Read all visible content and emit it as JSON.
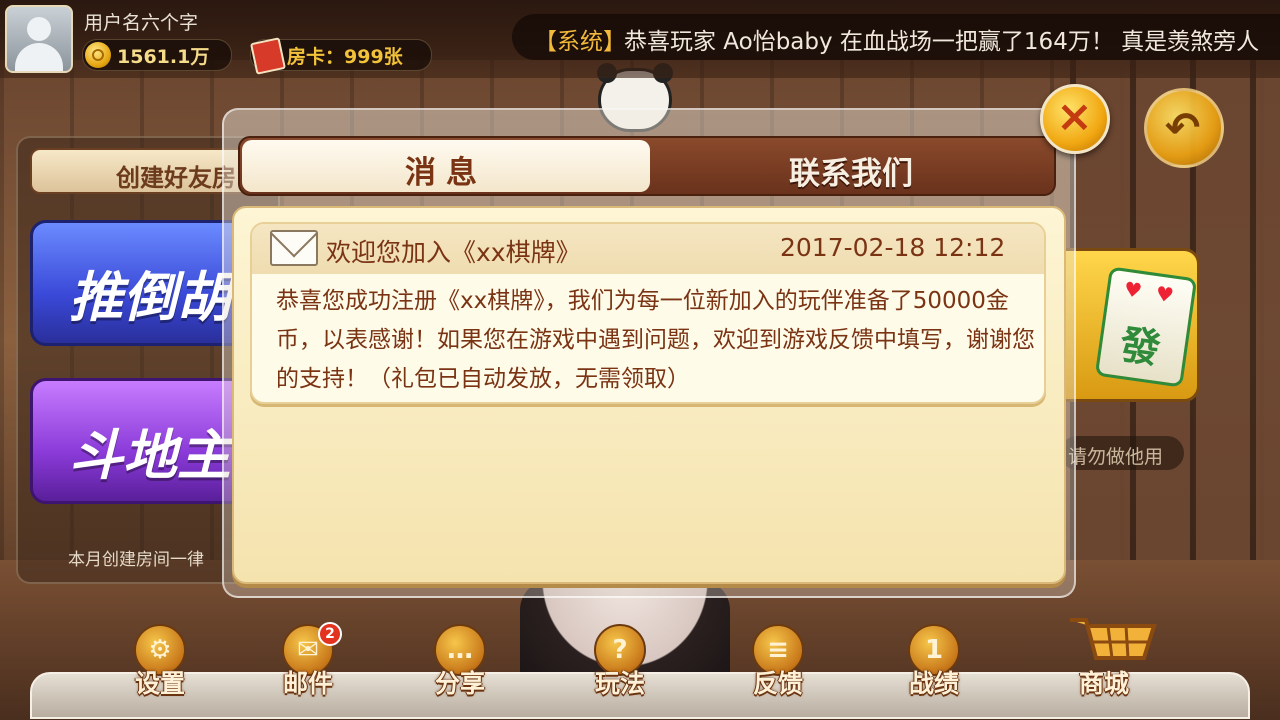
{
  "user": {
    "name": "用户名六个字",
    "coins": "1561.1万",
    "room_cards": "房卡：999张"
  },
  "marquee": {
    "tag": "【系统】",
    "text": "恭喜玩家 Ao怡baby 在血战场一把赢了164万！ 真是羡煞旁人"
  },
  "lobby": {
    "create_room_tab": "创建好友房",
    "games": [
      "推倒胡",
      "斗地主"
    ],
    "left_note": "本月创建房间一律",
    "right_note": "请勿做他用",
    "mahjong_tile": "發"
  },
  "dialog": {
    "tabs": [
      {
        "label": "消息",
        "active": true
      },
      {
        "label": "联系我们",
        "active": false
      }
    ],
    "messages": [
      {
        "title": "欢迎您加入《xx棋牌》",
        "time": "2017-02-18 12:12",
        "body": "恭喜您成功注册《xx棋牌》，我们为每一位新加入的玩伴准备了50000金币，以表感谢！如果您在游戏中遇到问题，欢迎到游戏反馈中填写，谢谢您的支持！（礼包已自动发放，无需领取）"
      }
    ]
  },
  "buttons": {
    "close": "×",
    "back": "↶"
  },
  "nav": [
    {
      "label": "设置",
      "icon": "gear-icon"
    },
    {
      "label": "邮件",
      "icon": "mail-icon",
      "badge": "2"
    },
    {
      "label": "分享",
      "icon": "chat-icon"
    },
    {
      "label": "玩法",
      "icon": "help-icon"
    },
    {
      "label": "反馈",
      "icon": "clipboard-icon"
    },
    {
      "label": "战绩",
      "icon": "trophy-icon"
    },
    {
      "label": "商城",
      "icon": "cart-icon"
    }
  ]
}
